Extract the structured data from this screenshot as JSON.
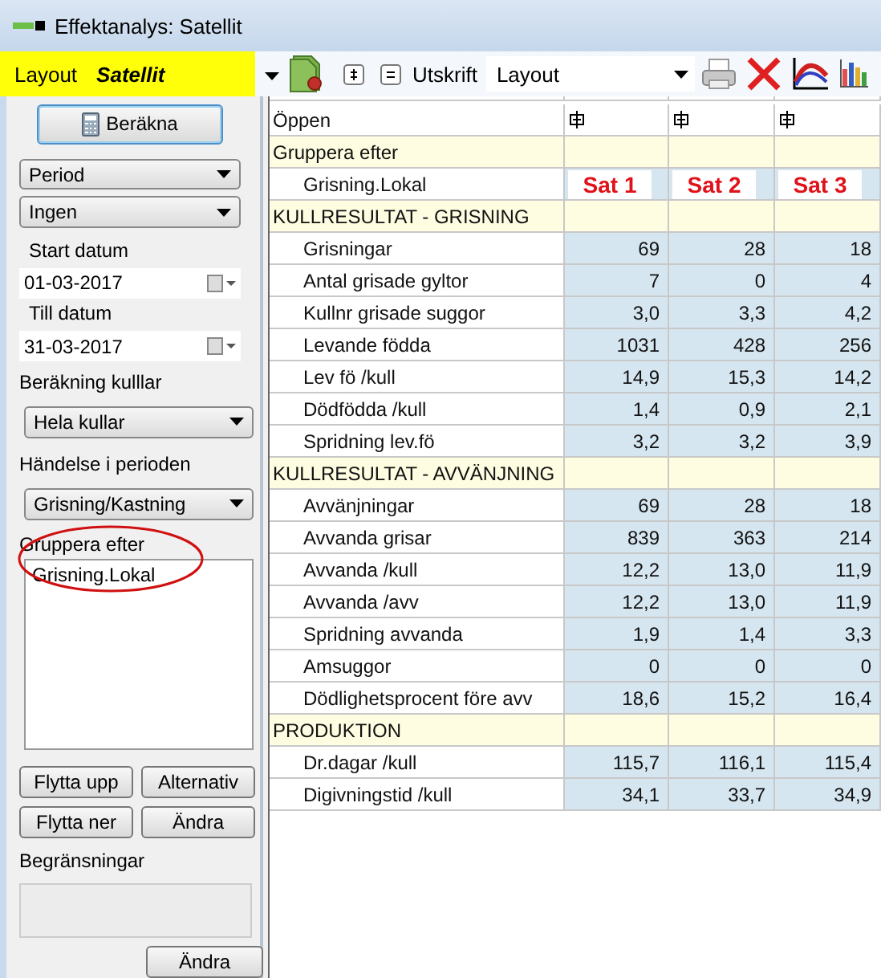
{
  "window": {
    "title": "Effektanalys: Satellit"
  },
  "toolbar": {
    "layout_label": "Layout",
    "layout_value": "Satellit",
    "print_label": "Utskrift",
    "print_value": "Layout"
  },
  "sidebar": {
    "calc_button": "Beräkna",
    "period": "Period",
    "period_type": "Ingen",
    "start_label": "Start datum",
    "start_date": "01-03-2017",
    "end_label": "Till datum",
    "end_date": "31-03-2017",
    "litter_label": "Beräkning kulllar",
    "litter_value": "Hela kullar",
    "event_label": "Händelse i perioden",
    "event_value": "Grisning/Kastning",
    "group_label": "Gruppera efter",
    "group_items": [
      "Grisning.Lokal"
    ],
    "buttons": [
      "Flytta upp",
      "Alternativ",
      "Flytta ner",
      "Ändra"
    ],
    "limits_label": "Begränsningar",
    "limits_button": "Ändra"
  },
  "grid": {
    "open_label": "Öppen",
    "group_label": "Gruppera efter",
    "group_field": "Grisning.Lokal",
    "columns": [
      "Sat 1",
      "Sat 2",
      "Sat 3"
    ],
    "sections": [
      {
        "title": "KULLRESULTAT - GRISNING",
        "rows": [
          {
            "label": "Grisningar",
            "values": [
              "69",
              "28",
              "18"
            ]
          },
          {
            "label": "Antal grisade gyltor",
            "values": [
              "7",
              "0",
              "4"
            ]
          },
          {
            "label": "Kullnr grisade suggor",
            "values": [
              "3,0",
              "3,3",
              "4,2"
            ]
          },
          {
            "label": "Levande födda",
            "values": [
              "1031",
              "428",
              "256"
            ]
          },
          {
            "label": "Lev fö /kull",
            "values": [
              "14,9",
              "15,3",
              "14,2"
            ]
          },
          {
            "label": "Dödfödda /kull",
            "values": [
              "1,4",
              "0,9",
              "2,1"
            ]
          },
          {
            "label": "Spridning lev.fö",
            "values": [
              "3,2",
              "3,2",
              "3,9"
            ]
          }
        ]
      },
      {
        "title": "KULLRESULTAT - AVVÄNJNING",
        "rows": [
          {
            "label": "Avvänjningar",
            "values": [
              "69",
              "28",
              "18"
            ]
          },
          {
            "label": "Avvanda grisar",
            "values": [
              "839",
              "363",
              "214"
            ]
          },
          {
            "label": "Avvanda /kull",
            "values": [
              "12,2",
              "13,0",
              "11,9"
            ]
          },
          {
            "label": "Avvanda /avv",
            "values": [
              "12,2",
              "13,0",
              "11,9"
            ]
          },
          {
            "label": "Spridning avvanda",
            "values": [
              "1,9",
              "1,4",
              "3,3"
            ]
          },
          {
            "label": "Amsuggor",
            "values": [
              "0",
              "0",
              "0"
            ]
          },
          {
            "label": "Dödlighetsprocent före avv",
            "values": [
              "18,6",
              "15,2",
              "16,4"
            ]
          }
        ]
      },
      {
        "title": "PRODUKTION",
        "rows": [
          {
            "label": "Dr.dagar /kull",
            "values": [
              "115,7",
              "116,1",
              "115,4"
            ]
          },
          {
            "label": "Digivningstid /kull",
            "values": [
              "34,1",
              "33,7",
              "34,9"
            ]
          }
        ]
      }
    ]
  }
}
